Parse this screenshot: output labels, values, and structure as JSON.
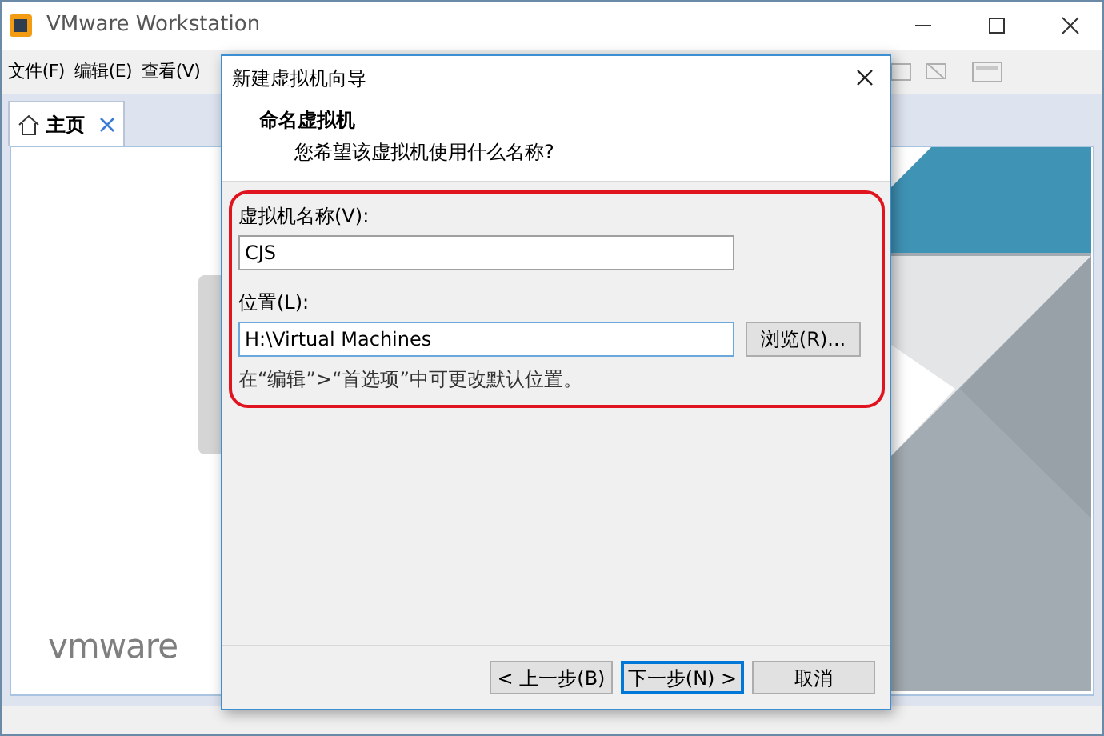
{
  "window": {
    "title": "VMware Workstation"
  },
  "menu": [
    "文件(F)",
    "编辑(E)",
    "查看(V)"
  ],
  "tabs": [
    {
      "label": "主页",
      "selected": true
    }
  ],
  "logo": "vmware",
  "dialog": {
    "title": "新建虚拟机向导",
    "heading": "命名虚拟机",
    "subtitle": "您希望该虚拟机使用什么名称?",
    "name_label": "虚拟机名称(V):",
    "name_value": "CJS",
    "location_label": "位置(L):",
    "location_value": "H:\\Virtual Machines",
    "browse": "浏览(R)...",
    "hint": "在“编辑”>“首选项”中可更改默认位置。",
    "buttons": [
      {
        "label": "< 上一步(B)",
        "focused": false
      },
      {
        "label": "下一步(N) >",
        "focused": true
      },
      {
        "label": "取消",
        "focused": false
      }
    ]
  }
}
